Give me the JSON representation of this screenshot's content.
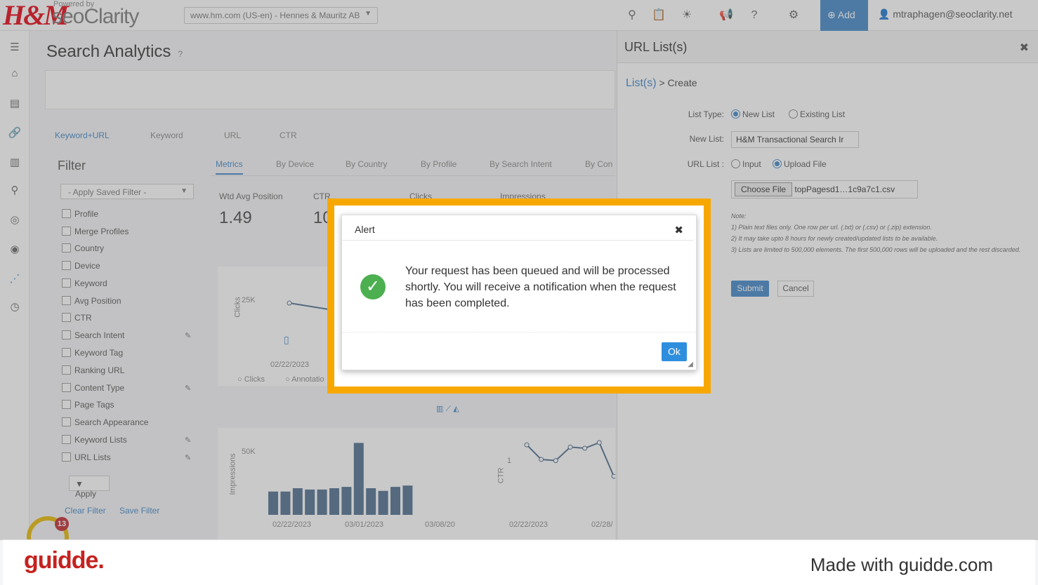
{
  "topbar": {
    "brand_hm": "H&M",
    "powered_by": "Powered by",
    "brand_seo": "seoClarity",
    "domain": "www.hm.com (US-en) - Hennes & Mauritz AB",
    "add_label": "Add",
    "user": "mtraphagen@seoclarity.net",
    "icons": [
      "search-icon",
      "clipboard-icon",
      "lightbulb-icon",
      "megaphone-icon",
      "help-icon",
      "gear-icon",
      "plus-circle-icon",
      "user-icon"
    ]
  },
  "page": {
    "title": "Search Analytics",
    "subtabs": [
      "Keyword+URL",
      "Keyword",
      "URL",
      "CTR"
    ],
    "filter_title": "Filter",
    "saved_filter": "- Apply Saved Filter -",
    "filters": [
      "Profile",
      "Merge Profiles",
      "Country",
      "Device",
      "Keyword",
      "Avg Position",
      "CTR",
      "Search Intent",
      "Keyword Tag",
      "Ranking URL",
      "Content Type",
      "Page Tags",
      "Search Appearance",
      "Keyword Lists",
      "URL Lists"
    ],
    "apply": "Apply",
    "clear_filter": "Clear Filter",
    "save_filter": "Save Filter",
    "tabs": [
      "Metrics",
      "By Device",
      "By Country",
      "By Profile",
      "By Search Intent",
      "By Con"
    ],
    "metrics": [
      {
        "label": "Wtd Avg Position",
        "value": "1.49"
      },
      {
        "label": "CTR",
        "value": "10"
      },
      {
        "label": "Clicks",
        "value": ""
      },
      {
        "label": "Impressions",
        "value": ""
      }
    ],
    "chart1": {
      "ylabel": "Clicks",
      "ytick": "25K",
      "xtick": "02/22/2023",
      "legend": [
        "Clicks",
        "Annotatio"
      ]
    },
    "chart2": {
      "ylabel": "Impressions",
      "ytick": "50K",
      "xticks": [
        "02/22/2023",
        "03/01/2023",
        "03/08/20"
      ]
    },
    "chart3": {
      "ylabel": "CTR",
      "ytick": "1",
      "xticks": [
        "02/22/2023",
        "02/28/"
      ]
    },
    "notification_count": "13"
  },
  "chart_data": [
    {
      "type": "bar",
      "ylabel": "Impressions",
      "values": [
        35,
        35,
        40,
        38,
        38,
        40,
        42,
        108,
        40,
        36,
        42,
        44
      ],
      "ylim": [
        0,
        120
      ]
    },
    {
      "type": "line",
      "ylabel": "CTR",
      "values": [
        1.9,
        1.25,
        1.2,
        1.8,
        1.75,
        2.0,
        0.5
      ],
      "ylim": [
        0,
        2.5
      ]
    }
  ],
  "panel": {
    "title": "URL List(s)",
    "crumb_link": "List(s)",
    "crumb_rest": " > Create",
    "list_type_label": "List Type:",
    "list_type_options": [
      "New List",
      "Existing List"
    ],
    "new_list_label": "New List:",
    "new_list_value": "H&M Transactional Search Ir",
    "url_list_label": "URL List :",
    "url_list_options": [
      "Input",
      "Upload File"
    ],
    "choose_file": "Choose File",
    "file_name": "topPagesd1…1c9a7c1.csv",
    "notes": [
      "Note:",
      "1) Plain text files only. One row per url. (.txt) or (.csv) or (.zip) extension.",
      "2) It may take upto 8 hours for newly created/updated lists to be available.",
      "3) Lists are limited to 500,000 elements. The first 500,000 rows will be uploaded and the rest discarded."
    ],
    "submit": "Submit",
    "cancel": "Cancel"
  },
  "alert": {
    "title": "Alert",
    "message": "Your request has been queued and will be processed shortly. You will receive a notification when the request has been completed.",
    "ok": "Ok"
  },
  "footer": {
    "brand": "guidde.",
    "made_with": "Made with guidde.com"
  },
  "colors": {
    "accent": "#3f86c8",
    "highlight": "#f7a800",
    "success": "#4caf50",
    "brand_red": "#e50010"
  }
}
